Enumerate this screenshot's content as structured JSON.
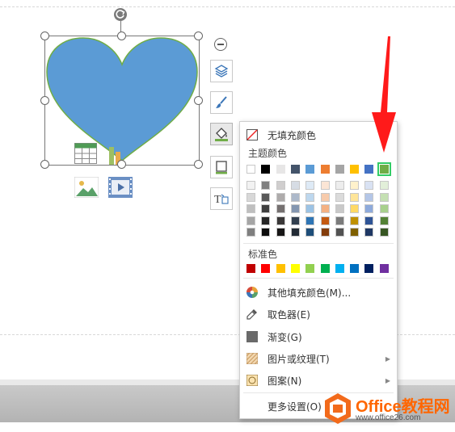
{
  "menu": {
    "no_fill": "无填充颜色",
    "theme_colors_title": "主题颜色",
    "standard_colors_title": "标准色",
    "other_fill": "其他填充颜色(M)...",
    "eyedropper": "取色器(E)",
    "gradient": "渐变(G)",
    "picture_texture": "图片或纹理(T)",
    "pattern": "图案(N)",
    "more_settings": "更多设置(O)"
  },
  "theme_top_row": [
    "#ffffff",
    "#000000",
    "#e7e6e6",
    "#44546a",
    "#5b9bd5",
    "#ed7d31",
    "#a5a5a5",
    "#ffc000",
    "#4472c4",
    "#70ad47"
  ],
  "theme_shades": [
    [
      "#f2f2f2",
      "#7f7f7f",
      "#d0cece",
      "#d6dce4",
      "#deeaf6",
      "#fbe5d5",
      "#ededed",
      "#fff2cc",
      "#d9e2f3",
      "#e2efd9"
    ],
    [
      "#d8d8d8",
      "#595959",
      "#aeabab",
      "#adb9ca",
      "#bdd7ee",
      "#f7cbac",
      "#dbdbdb",
      "#fee599",
      "#b4c6e7",
      "#c5e0b3"
    ],
    [
      "#bfbfbf",
      "#3f3f3f",
      "#757070",
      "#8496b0",
      "#9cc3e5",
      "#f4b183",
      "#c9c9c9",
      "#ffd965",
      "#8eaadb",
      "#a8d08d"
    ],
    [
      "#a5a5a5",
      "#262626",
      "#3a3838",
      "#323f4f",
      "#2e75b5",
      "#c45911",
      "#7b7b7b",
      "#bf9000",
      "#2f5496",
      "#538135"
    ],
    [
      "#7f7f7f",
      "#0c0c0c",
      "#171616",
      "#222a35",
      "#1e4e79",
      "#833c0b",
      "#525252",
      "#7f6000",
      "#1f3864",
      "#375623"
    ]
  ],
  "standard_colors": [
    "#c00000",
    "#ff0000",
    "#ffc000",
    "#ffff00",
    "#92d050",
    "#00b050",
    "#00b0f0",
    "#0070c0",
    "#002060",
    "#7030a0"
  ],
  "selected_color": "#70ad47",
  "shape": {
    "fill": "#5b9bd5",
    "outline": "#70ad47"
  },
  "watermark": {
    "text": "Office教程网",
    "url": "www.office26.com"
  },
  "icons": {
    "minus": "minus-circle-icon",
    "layers": "layers-icon",
    "brush": "brush-icon",
    "fill": "fill-bucket-icon",
    "outline": "outline-icon",
    "textbox": "textbox-icon"
  }
}
